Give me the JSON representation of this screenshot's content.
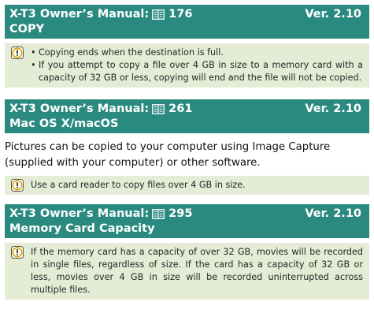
{
  "sections": [
    {
      "manual": "X-T3 Owner’s Manual:",
      "page": "176",
      "version": "Ver. 2.10",
      "title": "COPY",
      "notes": [
        "Copying ends when the destination is full.",
        "If you attempt to copy a file over 4 GB in size to a memory card with a capacity of 32 GB or less, copying will end and the file will not be copied."
      ]
    },
    {
      "manual": "X-T3 Owner’s Manual:",
      "page": "261",
      "version": "Ver. 2.10",
      "title": "Mac OS X/macOS",
      "paragraph": "Pictures can be copied to your computer using Image Capture (supplied with your computer) or other software.",
      "note": "Use a card reader to copy files over 4 GB in size."
    },
    {
      "manual": "X-T3 Owner’s Manual:",
      "page": "295",
      "version": "Ver. 2.10",
      "title": "Memory Card Capacity",
      "note": "If the memory card has a capacity of over 32 GB, movies will be recorded in single files, regardless of size. If the card has a capacity of 32 GB or less, movies over 4 GB in size will be recorded uninterrupted across multiple files."
    }
  ],
  "icons": {
    "book": "manual-page-icon",
    "caution": "caution-icon"
  },
  "colors": {
    "header_bg": "#2a8a80",
    "note_bg": "#e4ecd6",
    "icon_accent": "#d9a300"
  }
}
